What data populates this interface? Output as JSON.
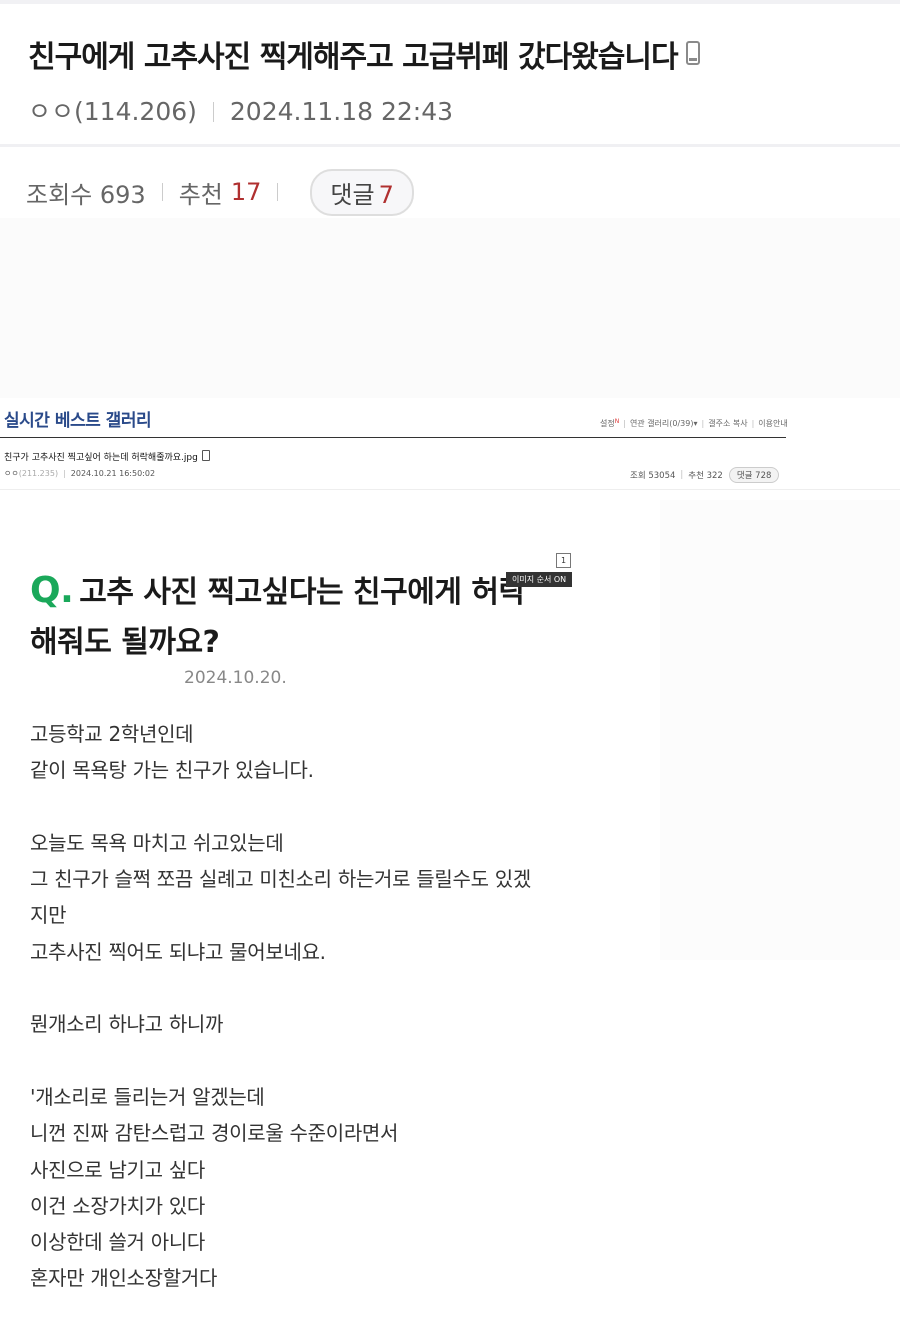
{
  "post": {
    "title": "친구에게 고추사진 찍게해주고 고급뷔페 갔다왔습니다",
    "author": "ㅇㅇ(114.206)",
    "datetime": "2024.11.18 22:43",
    "views_label": "조회수 693",
    "recommend_label": "추천",
    "recommend_count": "17",
    "comments_label": "댓글",
    "comments_count": "7"
  },
  "gallery": {
    "name": "실시간 베스트 갤러리",
    "links": [
      "설정",
      "연관 갤러리(0/39)▾",
      "갤주소 복사",
      "이용안내"
    ],
    "new_mark": "N",
    "post_title": "친구가 고추사진 찍고싶어 하는데 허락해줄까요.jpg",
    "author": "ㅇㅇ",
    "ip": "(211.235)",
    "datetime": "2024.10.21 16:50:02",
    "views": "조회 53054",
    "recommend": "추천 322",
    "comments": "댓글 728"
  },
  "content": {
    "q_mark": "Q.",
    "q_title_line1": "고추 사진 찍고싶다는 친구에게 허락",
    "q_title_line2": "해줘도 될까요?",
    "image_number": "1",
    "image_order_label": "이미지 순서 ON",
    "date": "2024.10.20.",
    "body_lines": [
      "고등학교 2학년인데",
      "같이 목욕탕 가는 친구가 있습니다.",
      "",
      "오늘도 목욕 마치고 쉬고있는데",
      "그 친구가 슬쩍 쪼끔 실례고 미친소리 하는거로 들릴수도 있겠",
      "지만",
      "고추사진 찍어도 되냐고 물어보네요.",
      "",
      "뭔개소리 하냐고 하니까",
      "",
      "'개소리로 들리는거 알겠는데",
      "니껀 진짜 감탄스럽고 경이로울 수준이라면서",
      "사진으로 남기고 싶다",
      "이건 소장가치가 있다",
      "이상한데 쓸거 아니다",
      "혼자만 개인소장할거다"
    ]
  }
}
